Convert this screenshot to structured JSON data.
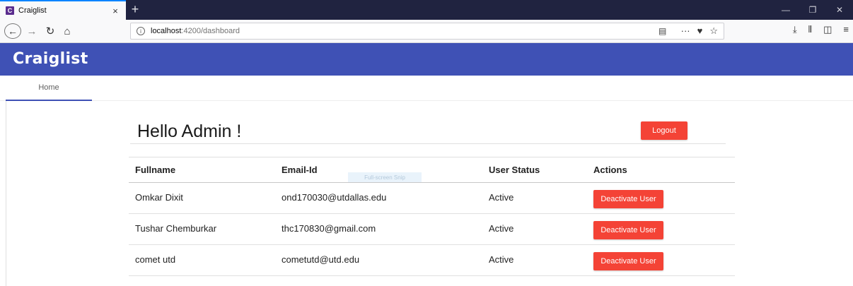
{
  "browser": {
    "tab_favicon": "C",
    "tab_title": "Craiglist",
    "tab_close": "×",
    "new_tab": "+",
    "url_host": "localhost",
    "url_path": ":4200/dashboard",
    "window_controls": [
      "—",
      "❐",
      "✕"
    ],
    "icons": [
      "back-arrow-icon",
      "forward-arrow-icon",
      "reload-icon",
      "home-icon",
      "info-icon",
      "reader-view-icon",
      "more-icon",
      "pocket-icon",
      "bookmark-star-icon",
      "downloads-icon",
      "library-icon",
      "sidebar-icon",
      "menu-icon"
    ]
  },
  "app": {
    "brand": "Craiglist",
    "tabs": [
      {
        "label": "Home"
      }
    ],
    "greeting": "Hello Admin !",
    "logout_label": "Logout",
    "tooltip_text": "Full-screen Snip",
    "accent_color": "#3f51b5",
    "button_color": "#f44336"
  },
  "table": {
    "headers": [
      "Fullname",
      "Email-Id",
      "User Status",
      "Actions"
    ],
    "rows": [
      {
        "fullname": "Omkar Dixit",
        "email": "ond170030@utdallas.edu",
        "status": "Active",
        "action": "Deactivate User"
      },
      {
        "fullname": "Tushar Chemburkar",
        "email": "thc170830@gmail.com",
        "status": "Active",
        "action": "Deactivate User"
      },
      {
        "fullname": "comet utd",
        "email": "cometutd@utd.edu",
        "status": "Active",
        "action": "Deactivate User"
      }
    ]
  }
}
